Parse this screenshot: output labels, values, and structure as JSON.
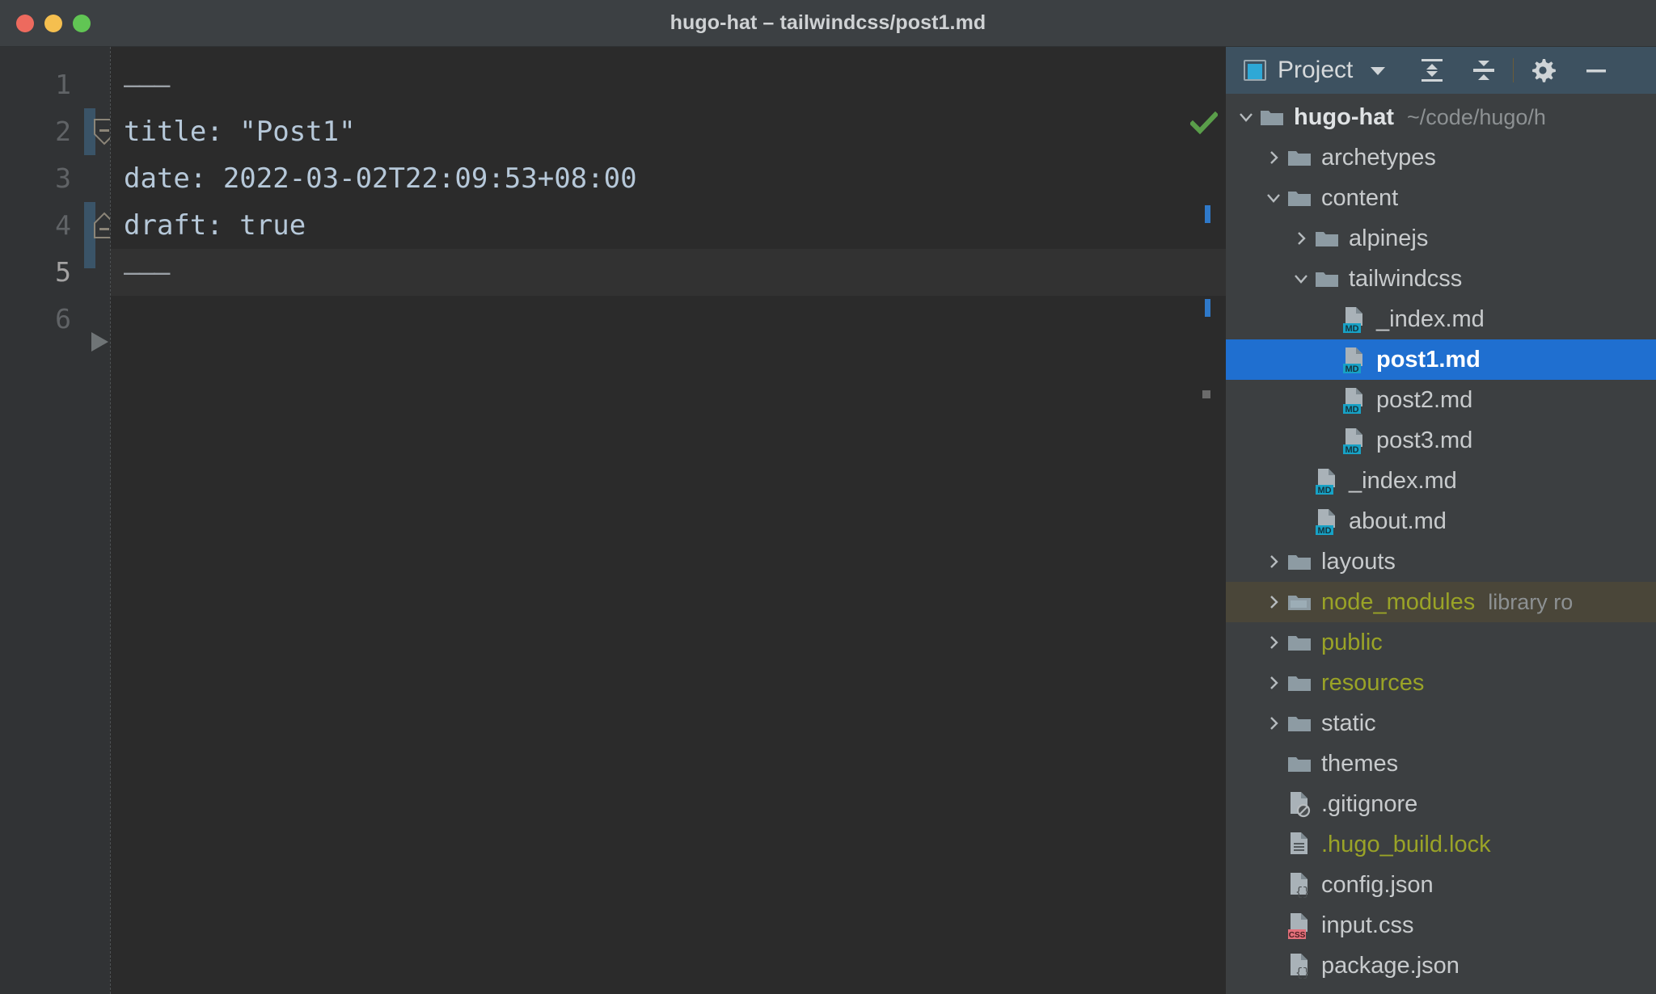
{
  "window": {
    "title": "hugo-hat – tailwindcss/post1.md",
    "traffic_lights": [
      "close-button",
      "minimize-button",
      "maximize-button"
    ]
  },
  "editor": {
    "language": "yaml-frontmatter",
    "inspection_status_icon": "green-checkmark-icon",
    "current_line": 5,
    "line_numbers": [
      "1",
      "2",
      "3",
      "4",
      "5",
      "6"
    ],
    "lines": [
      {
        "n": "1",
        "text": "---"
      },
      {
        "n": "2",
        "text": "title: \"Post1\""
      },
      {
        "n": "3",
        "text": "date: 2022-03-02T22:09:53+08:00"
      },
      {
        "n": "4",
        "text": "draft: true"
      },
      {
        "n": "5",
        "text": "---"
      },
      {
        "n": "6",
        "text": ""
      }
    ],
    "code": {
      "l1": "———",
      "l2": "title: \"Post1\"",
      "l3": "date: 2022-03-02T22:09:53+08:00",
      "l4": "draft: true",
      "l5": "———",
      "l6": ""
    }
  },
  "panel": {
    "title": "Project",
    "icons": {
      "project": "project-icon",
      "dropdown": "chevron-down-icon",
      "expand_all": "expand-all-icon",
      "collapse_all": "collapse-all-icon",
      "settings": "gear-icon",
      "hide": "minimize-icon"
    },
    "tree": [
      {
        "label": "hugo-hat",
        "hint": "~/code/hugo/h",
        "type": "folder",
        "indent": 0,
        "twisty": "down",
        "style": "root"
      },
      {
        "label": "archetypes",
        "hint": "",
        "type": "folder",
        "indent": 1,
        "twisty": "right",
        "style": "normal"
      },
      {
        "label": "content",
        "hint": "",
        "type": "folder",
        "indent": 1,
        "twisty": "down",
        "style": "normal"
      },
      {
        "label": "alpinejs",
        "hint": "",
        "type": "folder",
        "indent": 2,
        "twisty": "right",
        "style": "normal"
      },
      {
        "label": "tailwindcss",
        "hint": "",
        "type": "folder",
        "indent": 2,
        "twisty": "down",
        "style": "normal"
      },
      {
        "label": "_index.md",
        "hint": "",
        "type": "md",
        "indent": 3,
        "twisty": "none",
        "style": "normal"
      },
      {
        "label": "post1.md",
        "hint": "",
        "type": "md",
        "indent": 3,
        "twisty": "none",
        "style": "selected"
      },
      {
        "label": "post2.md",
        "hint": "",
        "type": "md",
        "indent": 3,
        "twisty": "none",
        "style": "normal"
      },
      {
        "label": "post3.md",
        "hint": "",
        "type": "md",
        "indent": 3,
        "twisty": "none",
        "style": "normal"
      },
      {
        "label": "_index.md",
        "hint": "",
        "type": "md",
        "indent": 2,
        "twisty": "none",
        "style": "normal"
      },
      {
        "label": "about.md",
        "hint": "",
        "type": "md",
        "indent": 2,
        "twisty": "none",
        "style": "normal"
      },
      {
        "label": "layouts",
        "hint": "",
        "type": "folder",
        "indent": 1,
        "twisty": "right",
        "style": "normal"
      },
      {
        "label": "node_modules",
        "hint": "library ro",
        "type": "folder",
        "indent": 1,
        "twisty": "right",
        "style": "olive-hovered"
      },
      {
        "label": "public",
        "hint": "",
        "type": "folder",
        "indent": 1,
        "twisty": "right",
        "style": "olive"
      },
      {
        "label": "resources",
        "hint": "",
        "type": "folder",
        "indent": 1,
        "twisty": "right",
        "style": "olive"
      },
      {
        "label": "static",
        "hint": "",
        "type": "folder",
        "indent": 1,
        "twisty": "right",
        "style": "normal"
      },
      {
        "label": "themes",
        "hint": "",
        "type": "folder",
        "indent": 1,
        "twisty": "none",
        "style": "normal"
      },
      {
        "label": ".gitignore",
        "hint": "",
        "type": "ignore",
        "indent": 1,
        "twisty": "none",
        "style": "normal"
      },
      {
        "label": ".hugo_build.lock",
        "hint": "",
        "type": "lock",
        "indent": 1,
        "twisty": "none",
        "style": "olive"
      },
      {
        "label": "config.json",
        "hint": "",
        "type": "json",
        "indent": 1,
        "twisty": "none",
        "style": "normal"
      },
      {
        "label": "input.css",
        "hint": "",
        "type": "css",
        "indent": 1,
        "twisty": "none",
        "style": "normal"
      },
      {
        "label": "package.json",
        "hint": "",
        "type": "json",
        "indent": 1,
        "twisty": "none",
        "style": "normal"
      }
    ]
  },
  "colors": {
    "selection_blue": "#1f6fd0",
    "md_badge": "#17a2c6",
    "css_badge": "#e3707a",
    "olive_text": "#9aa327",
    "panel_bg": "#3c3f41",
    "editor_bg": "#2b2b2b",
    "header_bg": "#3d5160",
    "check_green": "#5a9e4a",
    "vcs_blue": "#3a5468"
  }
}
